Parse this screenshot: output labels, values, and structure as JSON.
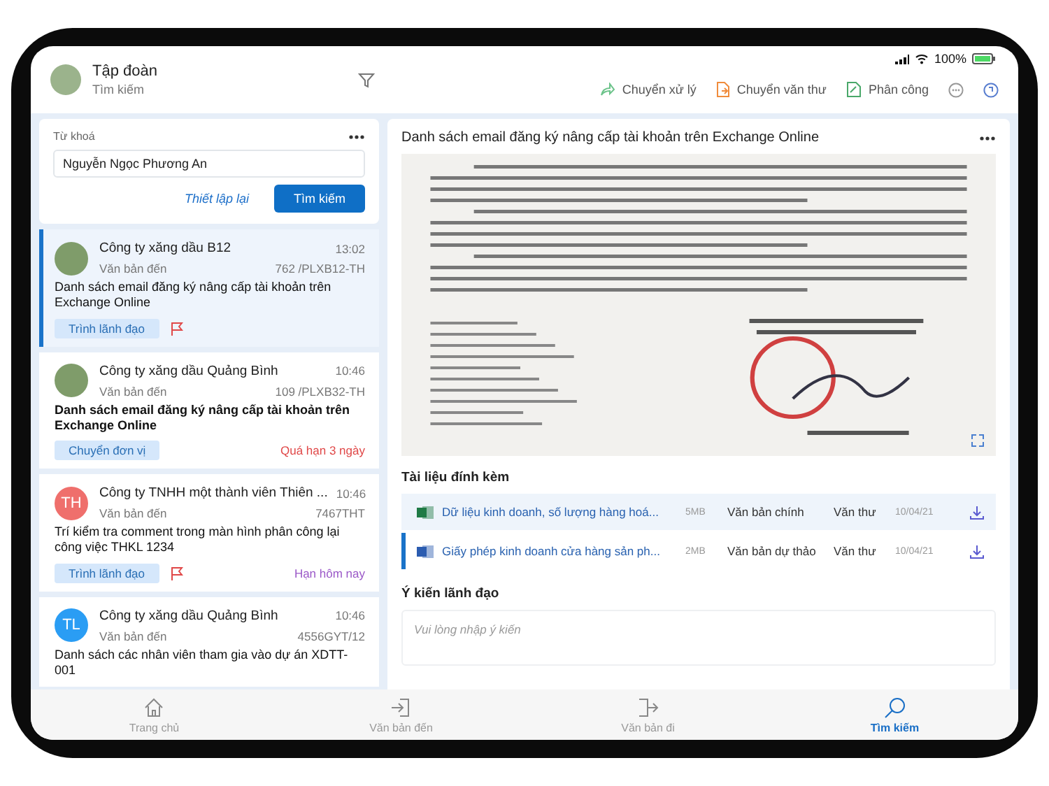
{
  "header": {
    "title": "Tập đoàn",
    "subtitle": "Tìm kiếm"
  },
  "status": {
    "battery": "100%"
  },
  "actions": [
    {
      "kind": "forward",
      "label": "Chuyển xử lý"
    },
    {
      "kind": "document",
      "label": "Chuyển văn thư"
    },
    {
      "kind": "assign",
      "label": "Phân công"
    }
  ],
  "search": {
    "label": "Từ khoá",
    "value": "Nguyễn Ngọc Phương An",
    "reset": "Thiết lập lại",
    "submit": "Tìm kiếm"
  },
  "items": [
    {
      "kind": "photo",
      "company": "Công ty xăng dầu B12",
      "type": "Văn bản đến",
      "time": "13:02",
      "number": "762 /PLXB12-TH",
      "subject": "Danh sách email đăng ký nâng cấp tài khoản trên Exchange Online",
      "unread": false,
      "tag": "Trình lãnh đạo",
      "flag": true,
      "selected": true
    },
    {
      "kind": "photo",
      "company": "Công ty xăng dầu Quảng Bình",
      "type": "Văn bản đến",
      "time": "10:46",
      "number": "109 /PLXB32-TH",
      "subject": "Danh sách email đăng ký nâng cấp tài khoản trên Exchange Online",
      "unread": true,
      "tag": "Chuyển đơn vị",
      "flag": false,
      "due": {
        "text": "Quá hạn 3 ngày",
        "color": "#e04848"
      },
      "selected": false
    },
    {
      "kind": "initials",
      "initials": "TH",
      "color": "#ef6f6c",
      "company": "Công ty TNHH một thành viên Thiên ...",
      "type": "Văn bản đến",
      "time": "10:46",
      "number": "7467THT",
      "subject": "Trí kiểm tra comment trong màn hình phân công lại công việc THKL 1234",
      "unread": false,
      "tag": "Trình lãnh đạo",
      "flag": true,
      "due": {
        "text": "Hạn hôm nay",
        "color": "#9b59c8"
      },
      "selected": false
    },
    {
      "kind": "initials",
      "initials": "TL",
      "color": "#2a9df4",
      "company": "Công ty xăng dầu Quảng Bình",
      "type": "Văn bản đến",
      "time": "10:46",
      "number": "4556GYT/12",
      "subject": "Danh sách các nhân viên tham gia vào dự án XDTT-001",
      "unread": false,
      "flag": false,
      "selected": false
    }
  ],
  "detail": {
    "title": "Danh sách email đăng ký nâng cấp tài khoản trên Exchange Online"
  },
  "attachments_title": "Tài liệu đính kèm",
  "attachments": [
    {
      "kind": "excel",
      "name": "Dữ liệu kinh doanh, số lượng hàng hoá...",
      "size": "5MB",
      "doc_type": "Văn bản chính",
      "owner": "Văn thư",
      "date": "10/04/21",
      "selected": false
    },
    {
      "kind": "word",
      "name": "Giấy phép kinh doanh cửa hàng sản ph...",
      "size": "2MB",
      "doc_type": "Văn bản dự thảo",
      "owner": "Văn thư",
      "date": "10/04/21",
      "selected": true
    }
  ],
  "opinion": {
    "title": "Ý kiến lãnh đạo",
    "placeholder": "Vui lòng nhập ý kiến"
  },
  "nav": [
    {
      "label": "Trang chủ",
      "selected": false
    },
    {
      "label": "Văn bản đến",
      "selected": false
    },
    {
      "label": "Văn bản đi",
      "selected": false
    },
    {
      "label": "Tìm kiếm",
      "selected": true
    }
  ]
}
